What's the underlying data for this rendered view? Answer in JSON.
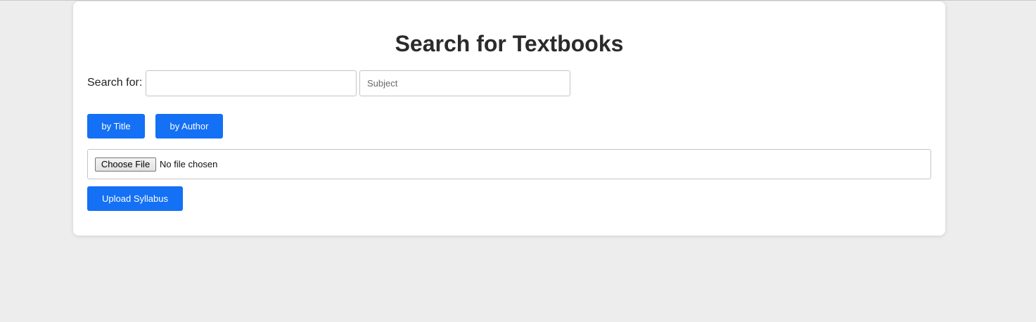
{
  "page": {
    "title": "Search for Textbooks"
  },
  "search": {
    "label": "Search for:",
    "query_value": "",
    "query_placeholder": "",
    "subject_value": "",
    "subject_placeholder": "Subject"
  },
  "buttons": {
    "by_title": "by Title",
    "by_author": "by Author",
    "upload": "Upload Syllabus"
  },
  "file_input": {
    "choose_label": "Choose File",
    "status": "No file chosen"
  },
  "colors": {
    "accent": "#1470f5",
    "background": "#ededed",
    "card": "#ffffff",
    "title_text": "#2b2b2b"
  }
}
